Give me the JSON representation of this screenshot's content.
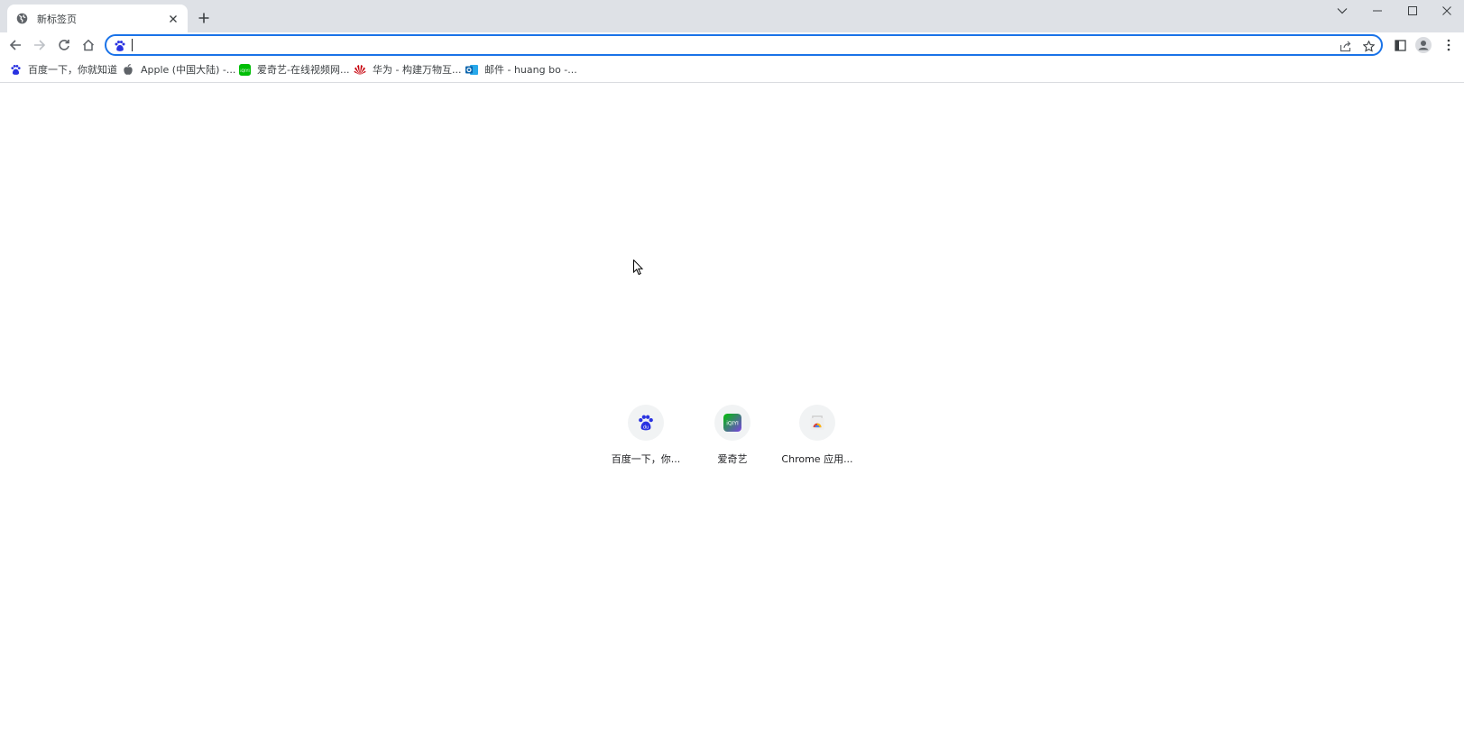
{
  "tab": {
    "title": "新标签页",
    "favicon": "globe-icon",
    "close_icon": "close-icon"
  },
  "newtab_icon": "plus-icon",
  "window_controls": [
    "chevron-down-icon",
    "minimize-icon",
    "maximize-icon",
    "close-icon"
  ],
  "nav": {
    "back_icon": "back-arrow-icon",
    "forward_icon": "forward-arrow-icon",
    "reload_icon": "reload-icon",
    "home_icon": "home-icon"
  },
  "omnibox": {
    "value": "",
    "placeholder": "",
    "leading_icon": "baidu-paw-icon",
    "share_icon": "share-icon",
    "star_icon": "star-icon"
  },
  "toolbar_right": [
    "side-panel-icon",
    "profile-avatar-icon",
    "more-menu-icon"
  ],
  "bookmarks": [
    {
      "label": "百度一下，你就知道",
      "icon": "baidu-paw-icon"
    },
    {
      "label": "Apple (中国大陆) -...",
      "icon": "apple-icon"
    },
    {
      "label": "爱奇艺-在线视频网...",
      "icon": "iqiyi-icon"
    },
    {
      "label": "华为 - 构建万物互...",
      "icon": "huawei-icon"
    },
    {
      "label": "邮件 - huang bo -...",
      "icon": "outlook-icon"
    }
  ],
  "shortcuts": [
    {
      "label": "百度一下，你...",
      "icon": "baidu-paw-icon"
    },
    {
      "label": "爱奇艺",
      "icon": "iqiyi-icon"
    },
    {
      "label": "Chrome 应用...",
      "icon": "chrome-webstore-icon"
    }
  ],
  "colors": {
    "accent": "#1a73e8",
    "titlebar": "#dee1e6",
    "baidu": "#2932e1",
    "iqiyi": "#00be06",
    "huawei": "#c7000b"
  }
}
